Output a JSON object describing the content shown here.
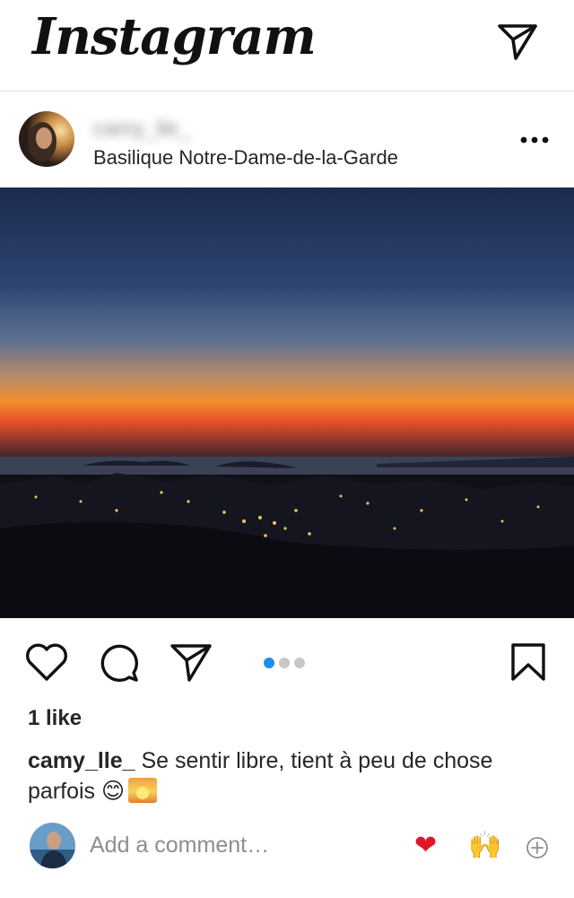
{
  "app": {
    "logo_text": "Instagram"
  },
  "post": {
    "username": "camy_lle_",
    "location": "Basilique Notre-Dame-de-la-Garde",
    "likes_text": "1 like",
    "caption_user": "camy_lle_",
    "caption_text": "Se sentir libre, tient à peu de chose parfois",
    "caption_emojis": [
      "😊",
      "🌅"
    ],
    "carousel": {
      "total": 3,
      "current": 1
    }
  },
  "comment_box": {
    "placeholder": "Add a comment…",
    "quick_reactions": [
      "❤",
      "🙌"
    ]
  },
  "icons": {
    "direct": "paper-plane-icon",
    "more": "more-horizontal-icon",
    "like": "heart-icon",
    "comment": "speech-bubble-icon",
    "share": "paper-plane-icon",
    "save": "bookmark-icon",
    "add": "plus-circle-icon"
  },
  "colors": {
    "accent_blue": "#1c8ef3",
    "text": "#262626",
    "muted": "#8e8e8e",
    "divider": "#dbdbdb",
    "heart_red": "#e0152a"
  }
}
